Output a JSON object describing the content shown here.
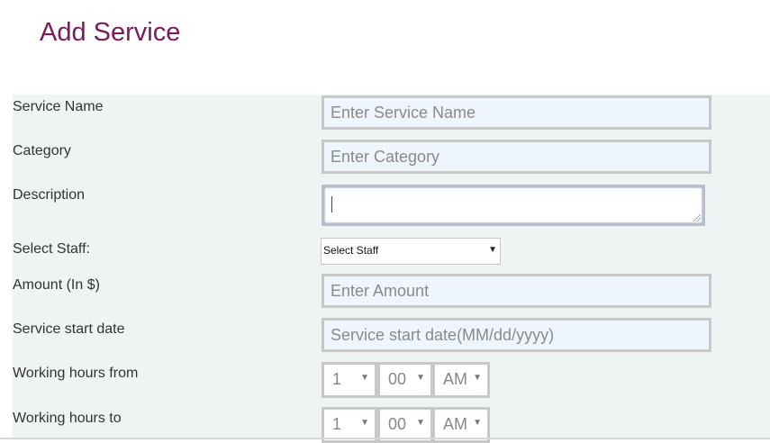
{
  "page": {
    "title": "Add Service"
  },
  "form": {
    "service_name": {
      "label": "Service Name",
      "placeholder": "Enter Service Name"
    },
    "category": {
      "label": "Category",
      "placeholder": "Enter Category"
    },
    "description": {
      "label": "Description",
      "value": ""
    },
    "staff": {
      "label": "Select Staff:",
      "selected": "Select Staff"
    },
    "amount": {
      "label": "Amount (In $)",
      "placeholder": "Enter Amount"
    },
    "start_date": {
      "label": "Service start date",
      "placeholder": "Service start date(MM/dd/yyyy)"
    },
    "hours_from": {
      "label": "Working hours from",
      "hour": "1",
      "minute": "00",
      "ampm": "AM"
    },
    "hours_to": {
      "label": "Working hours to",
      "hour": "1",
      "minute": "00",
      "ampm": "AM"
    }
  }
}
